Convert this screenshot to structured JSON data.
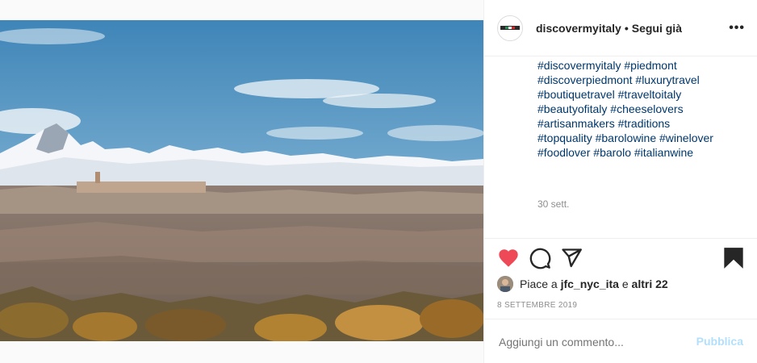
{
  "post": {
    "username": "discovermyitaly",
    "separator": "•",
    "follow_status": "Segui già",
    "more_label": "•••",
    "avatar_text": "Discover Italy",
    "hashtags": [
      "#discovermyitaly",
      "#piedmont",
      "#discoverpiedmont",
      "#luxurytravel",
      "#boutiquetravel",
      "#traveltoitaly",
      "#beautyofitaly",
      "#cheeselovers",
      "#artisanmakers",
      "#traditions",
      "#topquality",
      "#barolowine",
      "#winelover",
      "#foodlover",
      "#barolo",
      "#italianwine"
    ],
    "relative_time": "30 sett.",
    "likes": {
      "prefix": "Piace a",
      "user": "jfc_nyc_ita",
      "conjunction": "e",
      "others": "altri 22"
    },
    "date": "8 SETTEMBRE 2019",
    "comment": {
      "placeholder": "Aggiungi un commento...",
      "publish_label": "Pubblica"
    }
  },
  "colors": {
    "like_red": "#ed4956",
    "hashtag_blue": "#00376b",
    "publish_disabled": "#b2dffc",
    "muted": "#8e8e8e"
  },
  "icons": {
    "like": "heart-filled-icon",
    "comment": "speech-bubble-icon",
    "share": "paper-plane-icon",
    "save": "bookmark-filled-icon",
    "more": "ellipsis-icon"
  }
}
